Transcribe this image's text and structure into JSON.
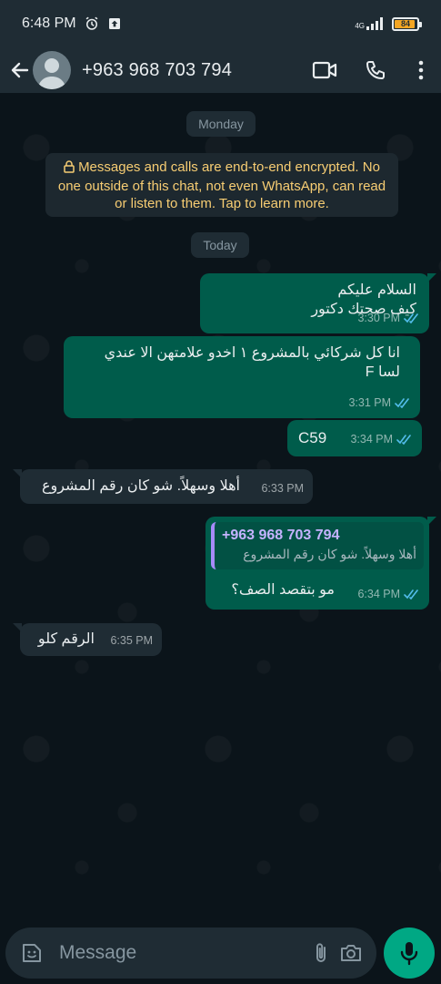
{
  "status_bar": {
    "time": "6:48 PM",
    "network": "4G",
    "battery": "84"
  },
  "app_bar": {
    "contact_name": "+963 968 703 794"
  },
  "chat": {
    "date_monday": "Monday",
    "date_today": "Today",
    "encryption_notice": "Messages and calls are end-to-end encrypted. No one outside of this chat, not even WhatsApp, can read or listen to them. Tap to learn more.",
    "messages": [
      {
        "direction": "out",
        "text": "السلام عليكم\nكيف صحتك دكتور",
        "time": "3:30 PM",
        "status": "read"
      },
      {
        "direction": "out",
        "text": "انا كل شركائي بالمشروع ١ اخدو علامتهن الا عندي\nلسا F",
        "time": "3:31 PM",
        "status": "read"
      },
      {
        "direction": "out",
        "text": "C59",
        "time": "3:34 PM",
        "status": "read"
      },
      {
        "direction": "in",
        "text": "أهلا وسهلاً. شو كان رقم المشروع",
        "time": "6:33 PM"
      },
      {
        "direction": "out",
        "quote_name": "+963 968 703 794",
        "quote_text": "أهلا وسهلاً. شو كان رقم المشروع",
        "text": "مو بتقصد الصف؟",
        "time": "6:34 PM",
        "status": "read"
      },
      {
        "direction": "in",
        "text": "الرقم كلو",
        "time": "6:35 PM"
      }
    ]
  },
  "composer": {
    "placeholder": "Message"
  },
  "colors": {
    "outgoing_bubble": "#005c4b",
    "incoming_bubble": "#1f2c34",
    "accent": "#00a884",
    "read_ticks": "#53bdeb",
    "notice_text": "#f7cd73"
  }
}
